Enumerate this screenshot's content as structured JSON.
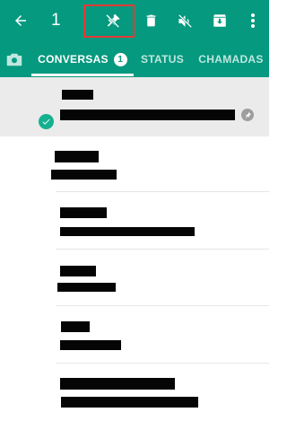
{
  "appbar": {
    "selected_count": "1",
    "icons": [
      "back-arrow-icon",
      "unpin-icon",
      "delete-icon",
      "mute-icon",
      "archive-icon",
      "more-vert-icon"
    ]
  },
  "tabs": {
    "camera_icon": "camera-icon",
    "items": [
      {
        "label": "CONVERSAS",
        "badge": "1",
        "active": true
      },
      {
        "label": "STATUS",
        "active": false
      },
      {
        "label": "CHAMADAS",
        "active": false
      }
    ]
  },
  "colors": {
    "toolbar": "#05997f",
    "selection_highlight": "#e53935",
    "selected_row": "#ebebeb",
    "check": "#15b08f"
  },
  "chats": [
    {
      "selected": true,
      "pinned": true,
      "name_redacted": true,
      "preview_redacted": true
    },
    {
      "selected": false,
      "pinned": false,
      "name_redacted": true,
      "preview_redacted": true
    },
    {
      "selected": false,
      "pinned": false,
      "name_redacted": true,
      "preview_redacted": true
    },
    {
      "selected": false,
      "pinned": false,
      "name_redacted": true,
      "preview_redacted": true
    },
    {
      "selected": false,
      "pinned": false,
      "name_redacted": true,
      "preview_redacted": true
    },
    {
      "selected": false,
      "pinned": false,
      "name_redacted": true,
      "preview_redacted": true
    }
  ]
}
